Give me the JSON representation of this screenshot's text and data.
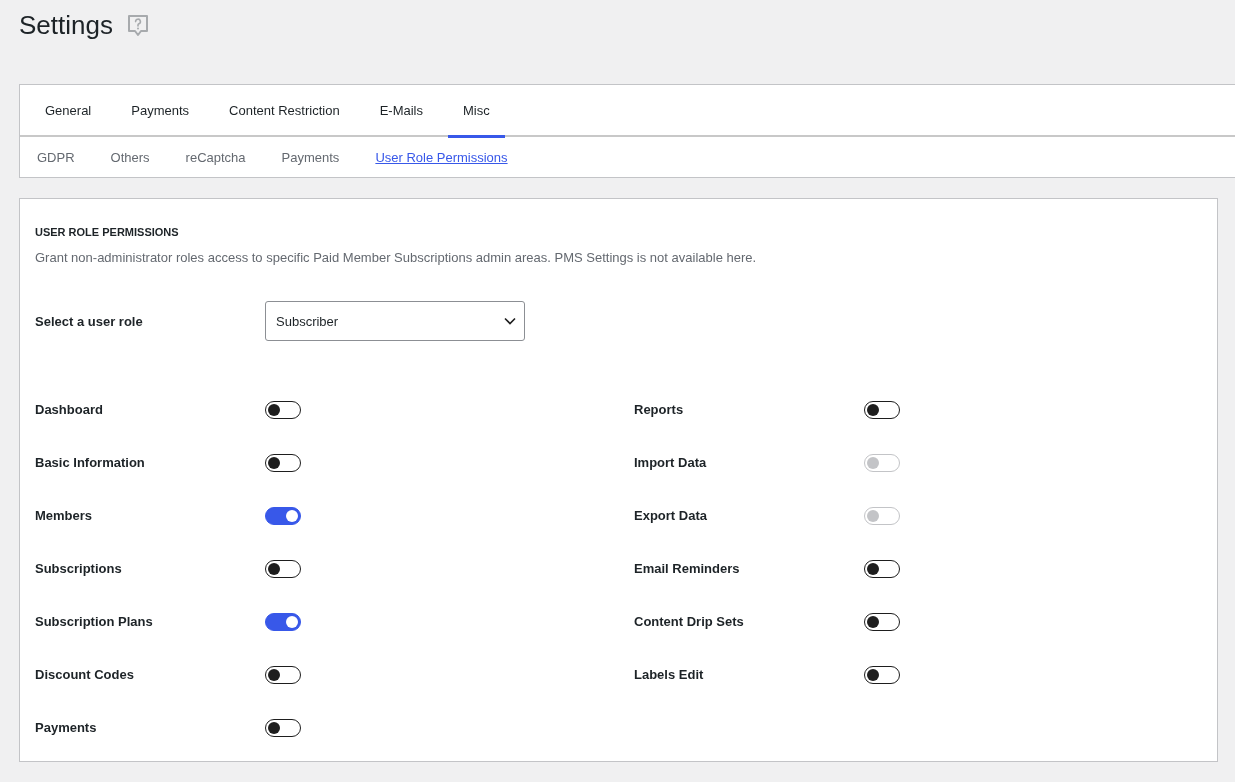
{
  "page_title": "Settings",
  "tabs": [
    {
      "label": "General",
      "selected": false
    },
    {
      "label": "Payments",
      "selected": false
    },
    {
      "label": "Content Restriction",
      "selected": false
    },
    {
      "label": "E-Mails",
      "selected": false
    },
    {
      "label": "Misc",
      "selected": true
    }
  ],
  "subtabs": [
    {
      "label": "GDPR",
      "selected": false
    },
    {
      "label": "Others",
      "selected": false
    },
    {
      "label": "reCaptcha",
      "selected": false
    },
    {
      "label": "Payments",
      "selected": false
    },
    {
      "label": "User Role Permissions",
      "selected": true
    }
  ],
  "section": {
    "heading": "USER ROLE PERMISSIONS",
    "description": "Grant non-administrator roles access to specific Paid Member Subscriptions admin areas. PMS Settings is not available here.",
    "role_select": {
      "label": "Select a user role",
      "value": "Subscriber"
    },
    "permission_columns": [
      {
        "items": [
          {
            "label": "Dashboard",
            "on": false,
            "disabled": false
          },
          {
            "label": "Basic Information",
            "on": false,
            "disabled": false
          },
          {
            "label": "Members",
            "on": true,
            "disabled": false
          },
          {
            "label": "Subscriptions",
            "on": false,
            "disabled": false
          },
          {
            "label": "Subscription Plans",
            "on": true,
            "disabled": false
          },
          {
            "label": "Discount Codes",
            "on": false,
            "disabled": false
          },
          {
            "label": "Payments",
            "on": false,
            "disabled": false
          }
        ]
      },
      {
        "items": [
          {
            "label": "Reports",
            "on": false,
            "disabled": false
          },
          {
            "label": "Import Data",
            "on": false,
            "disabled": true
          },
          {
            "label": "Export Data",
            "on": false,
            "disabled": true
          },
          {
            "label": "Email Reminders",
            "on": false,
            "disabled": false
          },
          {
            "label": "Content Drip Sets",
            "on": false,
            "disabled": false
          },
          {
            "label": "Labels Edit",
            "on": false,
            "disabled": false
          }
        ]
      }
    ]
  }
}
